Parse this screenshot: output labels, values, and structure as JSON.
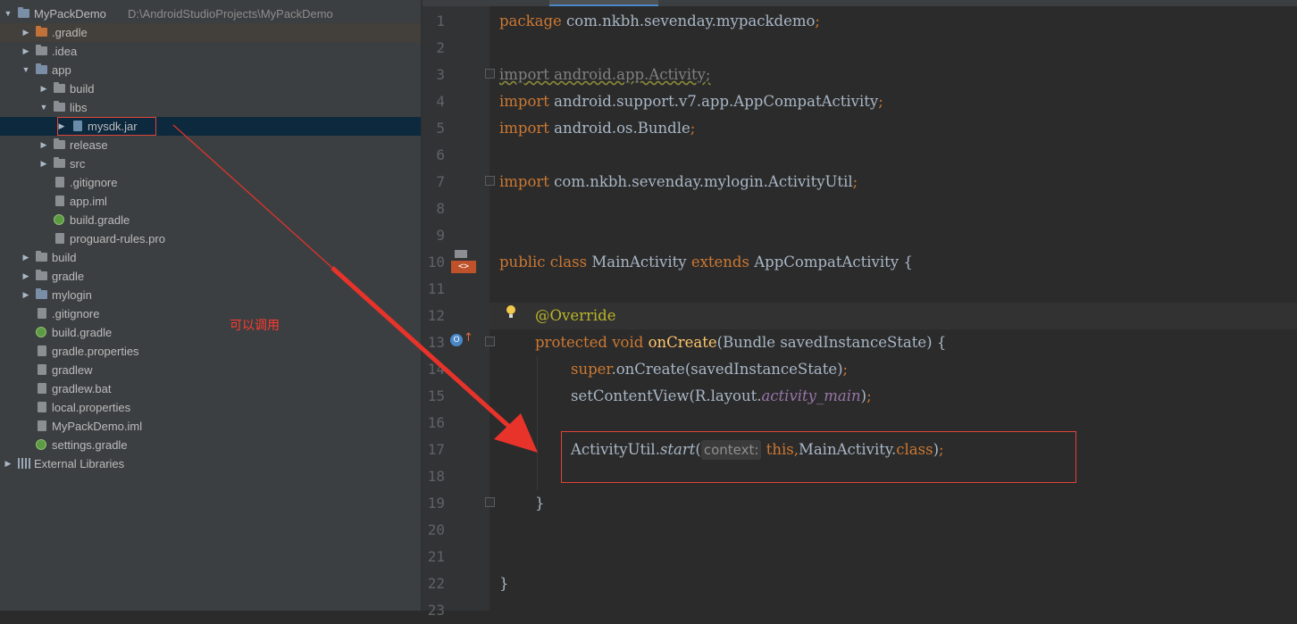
{
  "project_tree": {
    "root": {
      "name": "MyPackDemo",
      "path": "D:\\AndroidStudioProjects\\MyPackDemo"
    },
    "items": [
      {
        "label": "MyPackDemo",
        "extra": "D:\\AndroidStudioProjects\\MyPackDemo",
        "depth": 0,
        "icon": "module-folder-icon",
        "arrow": "expanded"
      },
      {
        "label": ".gradle",
        "depth": 1,
        "icon": "orange-folder-icon",
        "arrow": "collapsed"
      },
      {
        "label": ".idea",
        "depth": 1,
        "icon": "folder-icon",
        "arrow": "collapsed"
      },
      {
        "label": "app",
        "depth": 1,
        "icon": "module-folder-icon",
        "arrow": "expanded"
      },
      {
        "label": "build",
        "depth": 2,
        "icon": "folder-icon",
        "arrow": "collapsed"
      },
      {
        "label": "libs",
        "depth": 2,
        "icon": "folder-icon",
        "arrow": "expanded"
      },
      {
        "label": "mysdk.jar",
        "depth": 3,
        "icon": "jar-icon",
        "arrow": "collapsed",
        "selected": true
      },
      {
        "label": "release",
        "depth": 2,
        "icon": "folder-icon",
        "arrow": "collapsed"
      },
      {
        "label": "src",
        "depth": 2,
        "icon": "folder-icon",
        "arrow": "collapsed"
      },
      {
        "label": ".gitignore",
        "depth": 2,
        "icon": "file-icon"
      },
      {
        "label": "app.iml",
        "depth": 2,
        "icon": "file-icon"
      },
      {
        "label": "build.gradle",
        "depth": 2,
        "icon": "gradle-icon"
      },
      {
        "label": "proguard-rules.pro",
        "depth": 2,
        "icon": "file-icon"
      },
      {
        "label": "build",
        "depth": 1,
        "icon": "folder-icon",
        "arrow": "collapsed"
      },
      {
        "label": "gradle",
        "depth": 1,
        "icon": "folder-icon",
        "arrow": "collapsed"
      },
      {
        "label": "mylogin",
        "depth": 1,
        "icon": "module-folder-icon",
        "arrow": "collapsed"
      },
      {
        "label": ".gitignore",
        "depth": 1,
        "icon": "file-icon"
      },
      {
        "label": "build.gradle",
        "depth": 1,
        "icon": "gradle-icon"
      },
      {
        "label": "gradle.properties",
        "depth": 1,
        "icon": "file-icon"
      },
      {
        "label": "gradlew",
        "depth": 1,
        "icon": "file-icon"
      },
      {
        "label": "gradlew.bat",
        "depth": 1,
        "icon": "file-icon"
      },
      {
        "label": "local.properties",
        "depth": 1,
        "icon": "file-icon"
      },
      {
        "label": "MyPackDemo.iml",
        "depth": 1,
        "icon": "file-icon"
      },
      {
        "label": "settings.gradle",
        "depth": 1,
        "icon": "gradle-icon"
      },
      {
        "label": "External Libraries",
        "depth": 0,
        "icon": "libraries-icon",
        "arrow": "collapsed"
      }
    ]
  },
  "annotation": {
    "text": "可以调用",
    "color": "#ff3b30"
  },
  "editor": {
    "line_numbers": [
      "1",
      "2",
      "3",
      "4",
      "5",
      "6",
      "7",
      "8",
      "9",
      "10",
      "11",
      "12",
      "13",
      "14",
      "15",
      "16",
      "17",
      "18",
      "19",
      "20",
      "21",
      "22",
      "23"
    ],
    "code": {
      "l1": {
        "kw": "package",
        "rest": " com.nkbh.sevenday.mypackdemo",
        "semi": ";"
      },
      "l3": {
        "text": "import android.app.Activity;"
      },
      "l4": {
        "kw": "import",
        "rest": " android.support.v7.app.AppCompatActivity",
        "semi": ";"
      },
      "l5": {
        "kw": "import",
        "rest": " android.os.Bundle",
        "semi": ";"
      },
      "l7": {
        "kw": "import",
        "rest": " com.nkbh.sevenday.mylogin.ActivityUtil",
        "semi": ";"
      },
      "l10": {
        "kw1": "public class",
        "name": " MainActivity ",
        "kw2": "extends",
        "rest": " AppCompatActivity {"
      },
      "l12": {
        "annotation": "@Override"
      },
      "l13": {
        "kw": "protected void",
        "space": " ",
        "fn": "onCreate",
        "rest": "(Bundle savedInstanceState) {"
      },
      "l14": {
        "kw": "super",
        "rest": ".onCreate(savedInstanceState)",
        "semi": ";"
      },
      "l15": {
        "a": "setContentView(R.layout.",
        "field": "activity_main",
        "b": ")",
        "semi": ";"
      },
      "l17": {
        "a": "ActivityUtil.",
        "method": "start",
        "b": "(",
        "hint": "context:",
        "kw_this": "this,",
        "c": "MainActivity.",
        "kw_class": "class",
        "d": ")",
        "semi": ";"
      },
      "l19": {
        "text": "}"
      },
      "l22": {
        "text": "}"
      }
    }
  },
  "colors": {
    "keyword": "#cc7832",
    "annotation": "#bbb529",
    "method": "#ffc66d",
    "field": "#9876aa",
    "text": "#a9b7c6",
    "highlight_box": "#e0443a"
  }
}
